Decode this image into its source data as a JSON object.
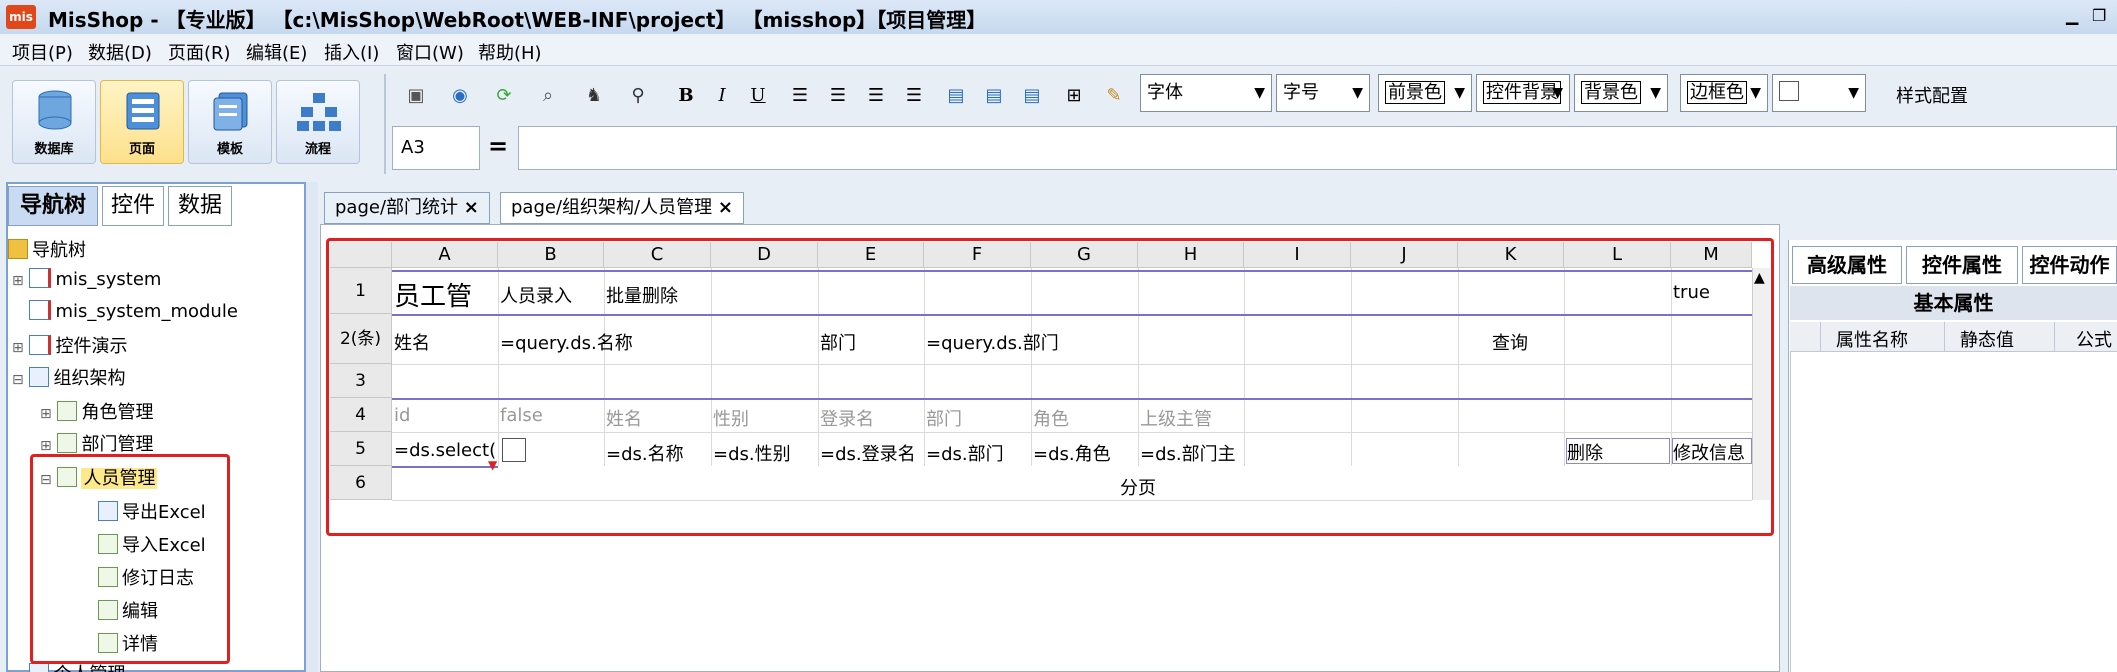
{
  "window": {
    "title": "MisShop - 【专业版】 【c:\\MisShop\\WebRoot\\WEB-INF\\project】 【misshop】【项目管理】",
    "logo_text": "mis",
    "minimize": "▁",
    "restore": "❐"
  },
  "menu": [
    "项目(P)",
    "数据(D)",
    "页面(R)",
    "编辑(E)",
    "插入(I)",
    "窗口(W)",
    "帮助(H)"
  ],
  "big_buttons": [
    {
      "label": "数据库",
      "icon": "database-icon"
    },
    {
      "label": "页面",
      "icon": "page-icon",
      "active": true
    },
    {
      "label": "模板",
      "icon": "template-icon"
    },
    {
      "label": "流程",
      "icon": "flow-icon"
    }
  ],
  "toolbar": {
    "bold": "B",
    "italic": "I",
    "underline": "U",
    "font": "字体",
    "font_size": "字号",
    "foreground": "前景色",
    "control_bg": "控件背景",
    "background": "背景色",
    "border_color": "边框色",
    "style_config": "样式配置"
  },
  "formula": {
    "cell_ref": "A3",
    "equals": "=",
    "value": ""
  },
  "left_tabs": [
    "导航树",
    "控件",
    "数据"
  ],
  "tree": [
    {
      "label": "导航树",
      "level": 0
    },
    {
      "label": "mis_system",
      "level": 1,
      "exp": "⊞"
    },
    {
      "label": "mis_system_module",
      "level": 1
    },
    {
      "label": "控件演示",
      "level": 1,
      "exp": "⊞"
    },
    {
      "label": "组织架构",
      "level": 1,
      "exp": "⊟"
    },
    {
      "label": "角色管理",
      "level": 2,
      "exp": "⊞"
    },
    {
      "label": "部门管理",
      "level": 2,
      "exp": "⊞"
    },
    {
      "label": "人员管理",
      "level": 2,
      "exp": "⊟",
      "selected": true
    },
    {
      "label": "导出Excel",
      "level": 3
    },
    {
      "label": "导入Excel",
      "level": 3
    },
    {
      "label": "修订日志",
      "level": 3
    },
    {
      "label": "编辑",
      "level": 3
    },
    {
      "label": "详情",
      "level": 3
    },
    {
      "label": "个人管理",
      "level": 1
    }
  ],
  "center_tabs": [
    {
      "label": "page/部门统计",
      "close": "×"
    },
    {
      "label": "page/组织架构/人员管理",
      "close": "×",
      "active": true
    }
  ],
  "grid": {
    "columns": [
      "A",
      "B",
      "C",
      "D",
      "E",
      "F",
      "G",
      "H",
      "I",
      "J",
      "K",
      "L",
      "M"
    ],
    "rows": [
      "1",
      "2(条)",
      "3",
      "4",
      "5",
      "6"
    ],
    "cells": {
      "r1": {
        "A": "员工管",
        "B": "人员录入",
        "C": "批量删除",
        "M": "true"
      },
      "r2": {
        "A": "姓名",
        "B": "=query.ds.名称",
        "E": "部门",
        "F": "=query.ds.部门",
        "K": "查询"
      },
      "r4": {
        "A": "id",
        "B": "false",
        "C": "姓名",
        "D": "性别",
        "E": "登录名",
        "F": "部门",
        "G": "角色",
        "H": "上级主管"
      },
      "r5": {
        "A": "=ds.select(d",
        "C": "=ds.名称",
        "D": "=ds.性别",
        "E": "=ds.登录名",
        "F": "=ds.部门",
        "G": "=ds.角色",
        "H": "=ds.部门主",
        "L": "删除",
        "M": "修改信息"
      },
      "r6": {
        "merged": "分页"
      }
    }
  },
  "right_tabs": [
    "高级属性",
    "控件属性",
    "控件动作"
  ],
  "props": {
    "section": "基本属性",
    "headers": [
      "属性名称",
      "静态值",
      "公式"
    ]
  }
}
